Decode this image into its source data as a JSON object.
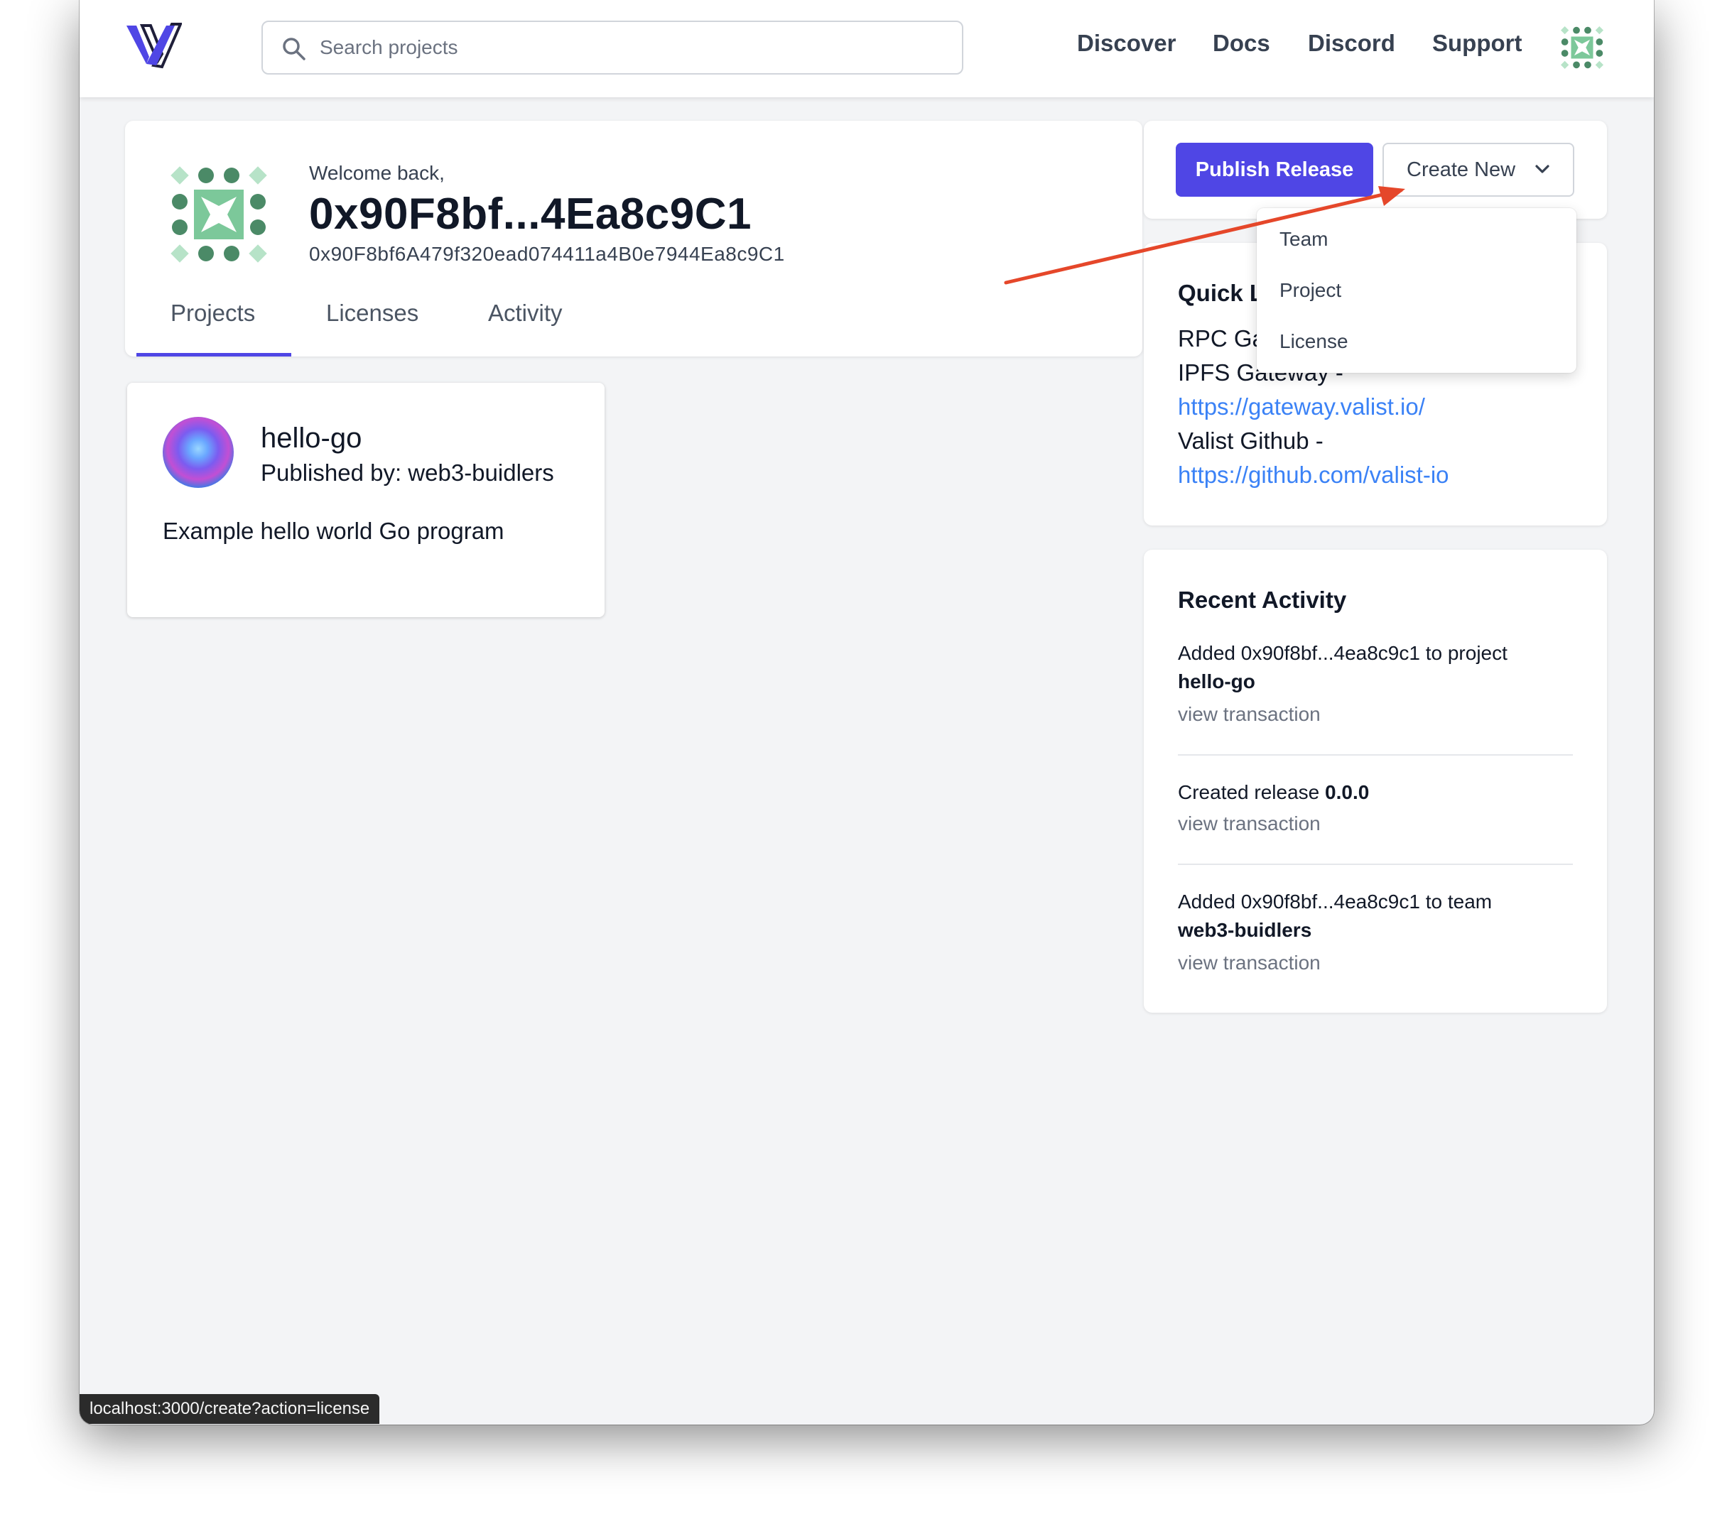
{
  "header": {
    "search_placeholder": "Search projects",
    "nav": [
      "Discover",
      "Docs",
      "Discord",
      "Support"
    ]
  },
  "profile": {
    "welcome": "Welcome back,",
    "address_short": "0x90F8bf...4Ea8c9C1",
    "address_full": "0x90F8bf6A479f320ead074411a4B0e7944Ea8c9C1",
    "tabs": [
      "Projects",
      "Licenses",
      "Activity"
    ],
    "active_tab": "Projects"
  },
  "project": {
    "name": "hello-go",
    "published_by": "Published by: web3-buidlers",
    "description": "Example hello world Go program"
  },
  "actions": {
    "publish_label": "Publish Release",
    "create_label": "Create New",
    "menu": [
      "Team",
      "Project",
      "License"
    ]
  },
  "quick_links": {
    "title": "Quick L",
    "rpc_label": "RPC Ga",
    "ipfs_label": "IPFS Gateway -",
    "ipfs_url": "https://gateway.valist.io/",
    "github_label": "Valist Github -",
    "github_url": "https://github.com/valist-io"
  },
  "activity": {
    "title": "Recent Activity",
    "items": [
      {
        "text": "Added 0x90f8bf...4ea8c9c1 to project",
        "bold": "hello-go",
        "link": "view transaction"
      },
      {
        "text": "Created release",
        "bold": "0.0.0",
        "link": "view transaction"
      },
      {
        "text": "Added 0x90f8bf...4ea8c9c1 to team",
        "bold": "web3-buidlers",
        "link": "view transaction"
      }
    ]
  },
  "status_bar": {
    "url": "localhost:3000/create?action=license"
  },
  "colors": {
    "accent": "#4f46e5",
    "link": "#3b82f6",
    "annotation_arrow": "#e5472a",
    "identicon_dark": "#4b8a67",
    "identicon_light": "#7cc89a",
    "identicon_pale": "#b7e3c8"
  }
}
